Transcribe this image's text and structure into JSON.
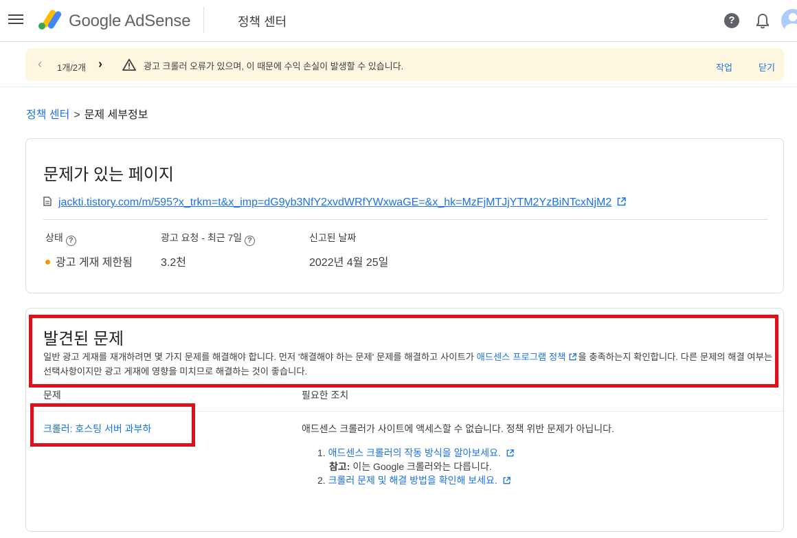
{
  "header": {
    "logo_text": "Google AdSense",
    "section_title": "정책 센터"
  },
  "banner": {
    "pager": "1개/2개",
    "message": "광고 크롤러 오류가 있으며, 이 때문에 수익 손실이 발생할 수 있습니다.",
    "action_label": "작업",
    "close_label": "닫기"
  },
  "breadcrumb": {
    "parent": "정책 센터",
    "current": "문제 세부정보"
  },
  "page_card": {
    "title": "문제가 있는 페이지",
    "url": "jackti.tistory.com/m/595?x_trkm=t&x_imp=dG9yb3NfY2xvdWRfYWxwaGE=&x_hk=MzFjMTJjYTM2YzBiNTcxNjM2",
    "status_label": "상태",
    "status_value": "광고 게재 제한됨",
    "requests_label": "광고 요청 - 최근 7일",
    "requests_value": "3.2천",
    "reported_label": "신고된 날짜",
    "reported_value": "2022년 4월 25일"
  },
  "issues_card": {
    "title": "발견된 문제",
    "desc_before": "일반 광고 게재를 재개하려면 몇 가지 문제를 해결해야 합니다. 먼저 '해결해야 하는 문제' 문제를 해결하고 사이트가 ",
    "desc_link": "애드센스 프로그램 정책",
    "desc_after": "을 충족하는지 확인합니다. 다른 문제의 해결 여부는 선택사항이지만 광고 게재에 영향을 미치므로 해결하는 것이 좋습니다.",
    "col_issue": "문제",
    "col_action": "필요한 조치",
    "issue_name": "크롤러: 호스팅 서버 과부하",
    "action_summary": "애드센스 크롤러가 사이트에 액세스할 수 없습니다. 정책 위반 문제가 아닙니다.",
    "step1_num": "1.",
    "step1_link": "애드센스 크롤러의 작동 방식을 알아보세요.",
    "note_label": "참고:",
    "note_text": " 이는 Google 크롤러와는 다릅니다.",
    "step2_num": "2.",
    "step2_link": "크롤러 문제 및 해결 방법을 확인해 보세요."
  },
  "colors": {
    "accent": "#1a73e8",
    "banner_bg": "#fef7e0",
    "status_dot": "#f29900",
    "highlight": "#e0101a"
  }
}
